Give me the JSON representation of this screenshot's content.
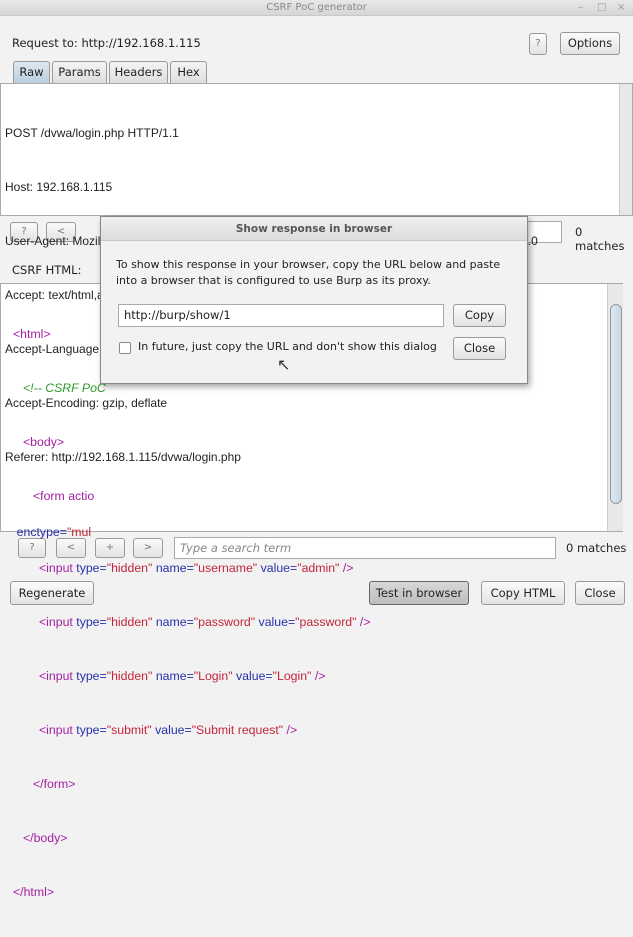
{
  "window": {
    "title": "CSRF PoC generator",
    "controls": [
      "–",
      "□",
      "×"
    ]
  },
  "header": {
    "request_to": "Request to: http://192.168.1.115",
    "help": "?",
    "options": "Options"
  },
  "tabs": [
    "Raw",
    "Params",
    "Headers",
    "Hex"
  ],
  "request_lines": [
    "POST /dvwa/login.php HTTP/1.1",
    "Host: 192.168.1.115",
    "User-Agent: Mozilla/5.0 (X11; Linux x86_64; rv:38.0) Gecko/20100101 Firefox/38.0 Iceweasel/38.5.0",
    "Accept: text/html,application/xhtml+xml,application/xml;q=0.9,*/*;q=0.8",
    "Accept-Language: en-US,en;q=0.5",
    "Accept-Encoding: gzip, deflate",
    "Referer: http://192.168.1.115/dvwa/login.php"
  ],
  "search_top": {
    "help": "?",
    "prev": "<",
    "matches": "0 matches"
  },
  "csrf_label": "CSRF HTML:",
  "code": {
    "l1": "<html>",
    "l2": "<!-- CSRF PoC",
    "l3": "<body>",
    "l4": "<form actio",
    "l5a": "enctype",
    "l5b": "=",
    "l5c": "\"mul",
    "input": "<input",
    "type": "type",
    "eq": "=",
    "name": "name",
    "value": "value",
    "close": "/>",
    "hidden": "\"hidden\"",
    "submit": "\"submit\"",
    "n_user": "\"username\"",
    "v_user": "\"admin\"",
    "n_pass": "\"password\"",
    "v_pass": "\"password\"",
    "n_login": "\"Login\"",
    "v_login": "\"Login\"",
    "v_submit": "\"Submit request\"",
    "form_end": "</form>",
    "body_end": "</body>",
    "html_end": "</html>"
  },
  "search_bottom": {
    "help": "?",
    "prev": "<",
    "add": "+",
    "next": ">",
    "placeholder": "Type a search term",
    "matches": "0 matches"
  },
  "footer": {
    "regenerate": "Regenerate",
    "test": "Test in browser",
    "copy_html": "Copy HTML",
    "close": "Close"
  },
  "dialog": {
    "title": "Show response in browser",
    "message": "To show this response in your browser, copy the URL below and paste into a browser that is configured to use Burp as its proxy.",
    "url": "http://burp/show/1",
    "copy": "Copy",
    "checkbox_label": "In future, just copy the URL and don't show this dialog",
    "checked": false,
    "close": "Close"
  }
}
